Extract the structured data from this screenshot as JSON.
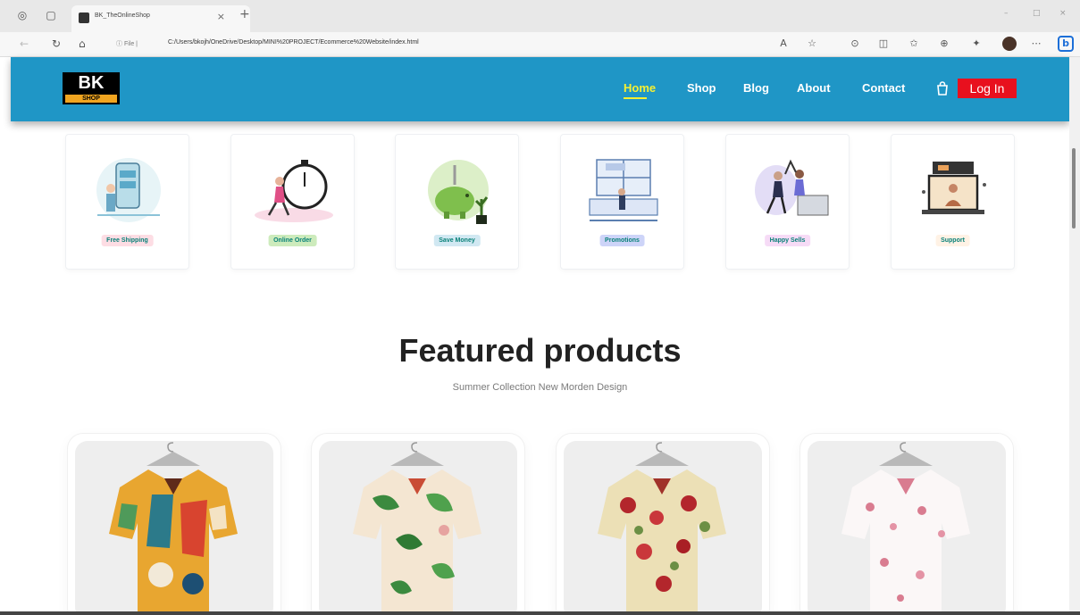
{
  "browser": {
    "tab_title": "BK_TheOnlineShop",
    "tab_close": "×",
    "new_tab": "+",
    "url_prefix": "ⓘ File |",
    "url": "C:/Users/bkojh/OneDrive/Desktop/MINI%20PROJECT/Ecommerce%20Website/index.html",
    "window_controls": [
      "–",
      "□",
      "×"
    ]
  },
  "header": {
    "logo_top": "BK",
    "logo_bottom": "SHOP",
    "nav": [
      {
        "label": "Home",
        "active": true
      },
      {
        "label": "Shop",
        "active": false
      },
      {
        "label": "Blog",
        "active": false
      },
      {
        "label": "About",
        "active": false
      },
      {
        "label": "Contact",
        "active": false
      }
    ],
    "login_label": "Log In"
  },
  "features": [
    {
      "label": "Free Shipping",
      "bg": "#fddde4"
    },
    {
      "label": "Online Order",
      "bg": "#cdebbc"
    },
    {
      "label": "Save Money",
      "bg": "#d1e8f2"
    },
    {
      "label": "Promotions",
      "bg": "#cdd4f8"
    },
    {
      "label": "Happy Sells",
      "bg": "#f6dbf6"
    },
    {
      "label": "Support",
      "bg": "#fff2e5"
    }
  ],
  "featured": {
    "title": "Featured products",
    "subtitle": "Summer Collection New Morden Design"
  },
  "colors": {
    "header_bg": "#1f96c6",
    "active_nav": "#f6f032",
    "login_bg": "#e8101e"
  }
}
